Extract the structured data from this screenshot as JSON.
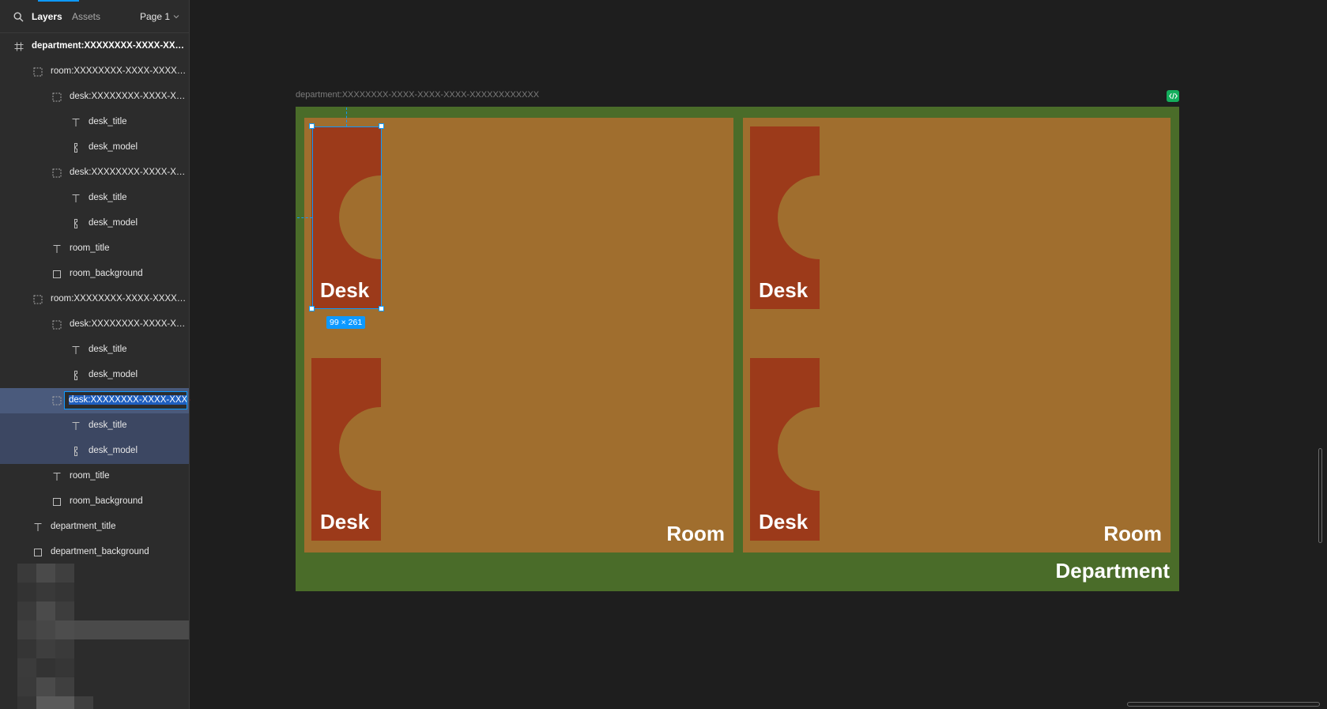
{
  "panel": {
    "tabs": {
      "layers": "Layers",
      "assets": "Assets"
    },
    "page_selector": "Page 1"
  },
  "layers": [
    {
      "depth": 0,
      "icon": "frame-icon",
      "label": "department:XXXXXXXX-XXXX-XXXX-XXXX-XXXXXXXXXXXX",
      "bold": true
    },
    {
      "depth": 1,
      "icon": "group-frame-icon",
      "label": "room:XXXXXXXX-XXXX-XXXX-XXXX-XXXXXXXXXXXX"
    },
    {
      "depth": 2,
      "icon": "group-frame-icon",
      "label": "desk:XXXXXXXX-XXXX-XXXX-XXXX-XXXXXXXXXXXX"
    },
    {
      "depth": 3,
      "icon": "text-icon",
      "label": "desk_title"
    },
    {
      "depth": 3,
      "icon": "vector-icon",
      "label": "desk_model"
    },
    {
      "depth": 2,
      "icon": "group-frame-icon",
      "label": "desk:XXXXXXXX-XXXX-XXXX-XXXX-XXXXXXXXXXXX"
    },
    {
      "depth": 3,
      "icon": "text-icon",
      "label": "desk_title"
    },
    {
      "depth": 3,
      "icon": "vector-icon",
      "label": "desk_model"
    },
    {
      "depth": 2,
      "icon": "text-icon",
      "label": "room_title"
    },
    {
      "depth": 2,
      "icon": "rectangle-icon",
      "label": "room_background"
    },
    {
      "depth": 1,
      "icon": "group-frame-icon",
      "label": "room:XXXXXXXX-XXXX-XXXX-XXXX-XXXXXXXXXXXX"
    },
    {
      "depth": 2,
      "icon": "group-frame-icon",
      "label": "desk:XXXXXXXX-XXXX-XXXX-XXXX-XXXXXXXXXXXX"
    },
    {
      "depth": 3,
      "icon": "text-icon",
      "label": "desk_title"
    },
    {
      "depth": 3,
      "icon": "vector-icon",
      "label": "desk_model"
    },
    {
      "depth": 2,
      "icon": "group-frame-icon",
      "label": "desk:XXXXXXXX-XXXX-XXXX",
      "state": "renaming"
    },
    {
      "depth": 3,
      "icon": "text-icon",
      "label": "desk_title",
      "state": "child-selected"
    },
    {
      "depth": 3,
      "icon": "vector-icon",
      "label": "desk_model",
      "state": "child-selected"
    },
    {
      "depth": 2,
      "icon": "text-icon",
      "label": "room_title"
    },
    {
      "depth": 2,
      "icon": "rectangle-icon",
      "label": "room_background"
    },
    {
      "depth": 1,
      "icon": "text-icon",
      "label": "department_title"
    },
    {
      "depth": 1,
      "icon": "rectangle-icon",
      "label": "department_background"
    }
  ],
  "canvas": {
    "frame_label": "department:XXXXXXXX-XXXX-XXXX-XXXX-XXXXXXXXXXXX",
    "department_title": "Department",
    "rooms": [
      {
        "title": "Room",
        "desks": [
          {
            "title": "Desk"
          },
          {
            "title": "Desk"
          }
        ]
      },
      {
        "title": "Room",
        "desks": [
          {
            "title": "Desk"
          },
          {
            "title": "Desk"
          }
        ]
      }
    ],
    "selection_size": "99 × 261"
  },
  "colors": {
    "department": "#4a6c29",
    "room": "#a06e2e",
    "desk": "#9c3a1a",
    "selection": "#0d99ff",
    "annotation_arrow": "#e01e1e",
    "code_badge": "#14ae5c"
  }
}
